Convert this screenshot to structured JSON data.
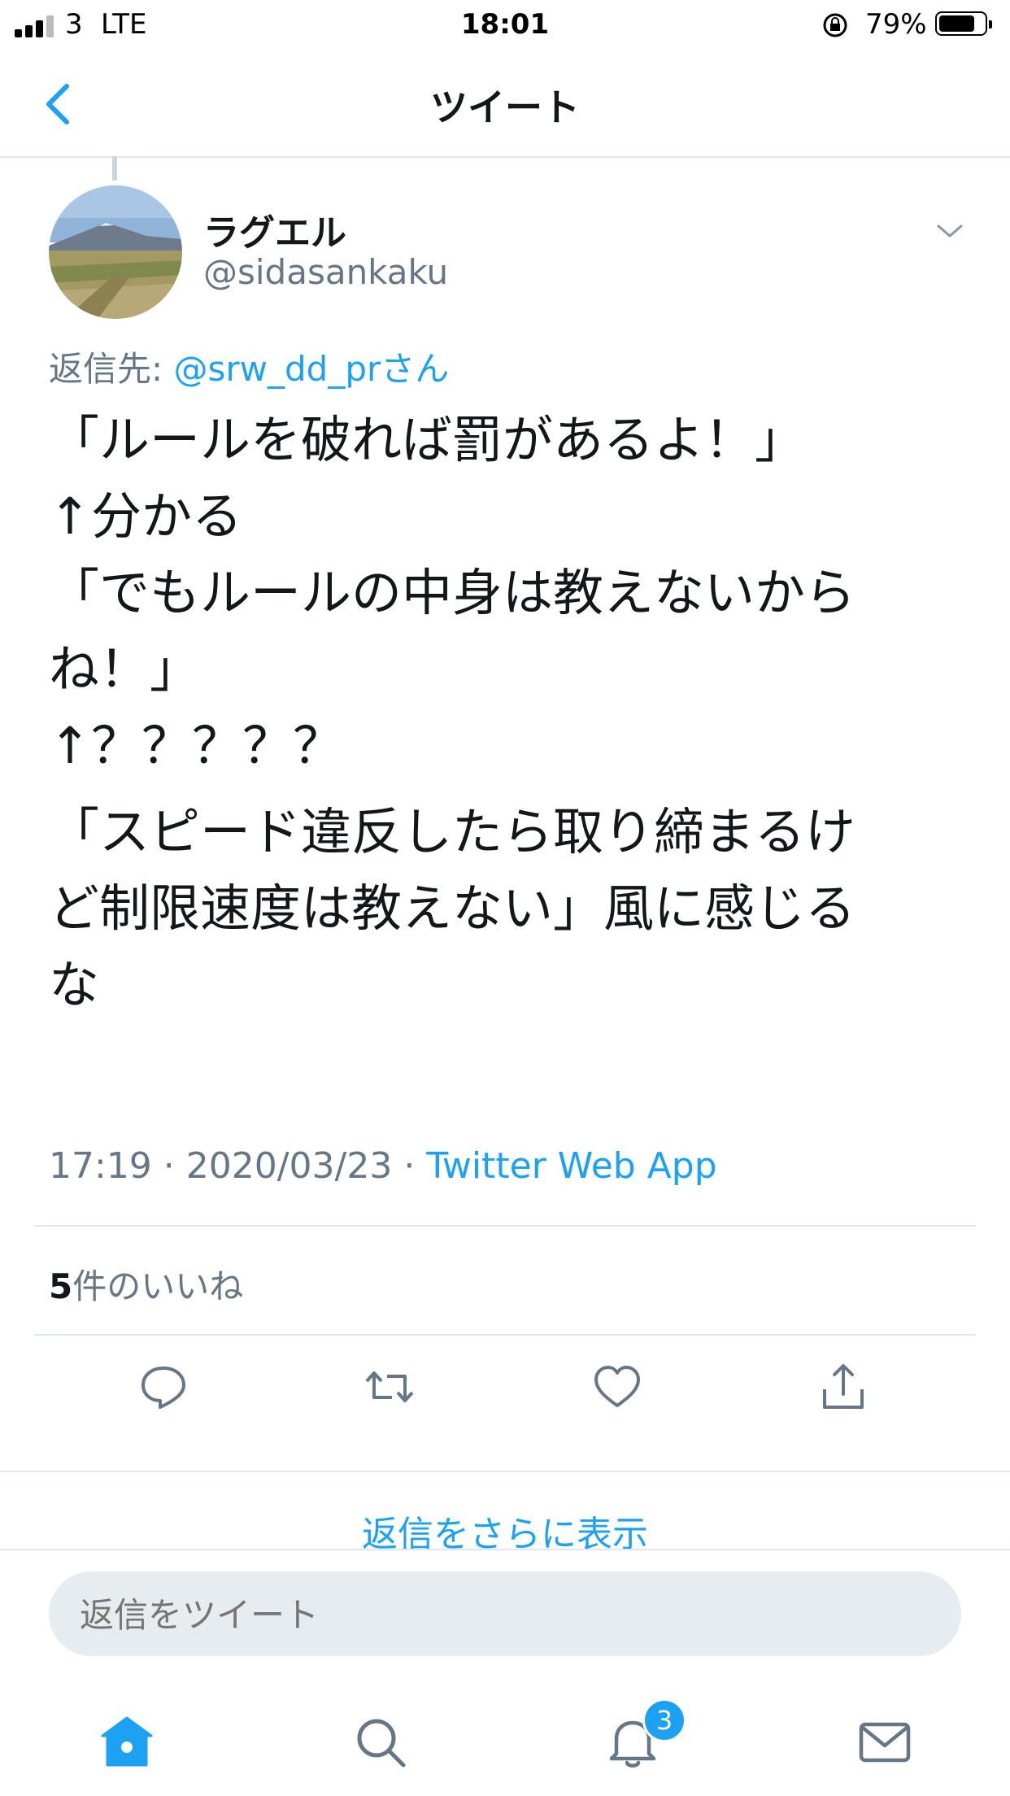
{
  "status_bar": {
    "carrier": "3",
    "network": "LTE",
    "time": "18:01",
    "battery_percent": "79%",
    "battery_level": 0.79
  },
  "nav": {
    "title": "ツイート",
    "back_icon": "chevron-left-icon"
  },
  "tweet": {
    "display_name": "ラグエル",
    "handle": "@sidasankaku",
    "reply_prefix": "返信先: ",
    "reply_to": "@srw_dd_prさん",
    "lines": [
      "「ルールを破れば罰があるよ！」",
      "↑分かる",
      "「でもルールの中身は教えないから",
      "ね！」",
      "↑？？？？？"
    ],
    "lines2": [
      "「スピード違反したら取り締まるけ",
      "ど制限速度は教えない」風に感じる",
      "な"
    ],
    "timestamp": "17:19 · 2020/03/23 · ",
    "source": "Twitter Web App",
    "likes_count": "5",
    "likes_label": "件のいいね"
  },
  "actions": [
    "reply-icon",
    "retweet-icon",
    "like-icon",
    "share-icon"
  ],
  "more_replies": "返信をさらに表示",
  "compose": {
    "placeholder": "返信をツイート"
  },
  "tabbar": {
    "items": [
      "home-icon",
      "search-icon",
      "notifications-icon",
      "messages-icon"
    ],
    "notification_badge": "3"
  },
  "colors": {
    "accent": "#1da1f2",
    "secondary_text": "#657786",
    "divider": "#e1e8ed"
  }
}
